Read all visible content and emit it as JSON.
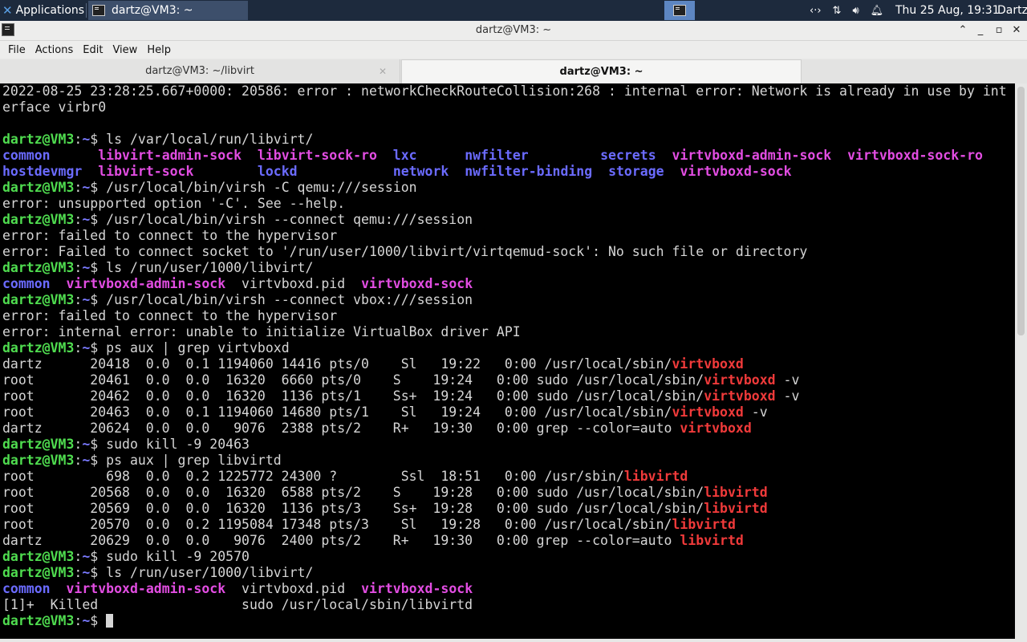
{
  "taskbar": {
    "applications_label": "Applications",
    "task_label": "dartz@VM3: ~",
    "clock": "Thu 25 Aug, 19:31",
    "user": "Dartz"
  },
  "window": {
    "title": "dartz@VM3: ~",
    "menu": [
      "File",
      "Actions",
      "Edit",
      "View",
      "Help"
    ]
  },
  "tabs": [
    {
      "label": "dartz@VM3: ~/libvirt"
    },
    {
      "label": "dartz@VM3: ~"
    }
  ],
  "terminal": {
    "prompt": "dartz@VM3",
    "lines": [
      [
        {
          "t": "2022-08-25 23:28:25.667+0000: 20586: error : networkCheckRouteCollision:268 : internal error: Network is already in use by int"
        }
      ],
      [
        {
          "t": "erface virbr0"
        }
      ],
      [
        {
          "t": ""
        }
      ],
      [
        {
          "t": "dartz@VM3",
          "c": "pg"
        },
        {
          "t": ":"
        },
        {
          "t": "~",
          "c": "pb"
        },
        {
          "t": "$ ls /var/local/run/libvirt/"
        }
      ],
      [
        {
          "t": "common",
          "c": "dir"
        },
        {
          "t": "      "
        },
        {
          "t": "libvirt-admin-sock",
          "c": "sock"
        },
        {
          "t": "  "
        },
        {
          "t": "libvirt-sock-ro",
          "c": "sock"
        },
        {
          "t": "  "
        },
        {
          "t": "lxc",
          "c": "dir"
        },
        {
          "t": "      "
        },
        {
          "t": "nwfilter",
          "c": "dir"
        },
        {
          "t": "         "
        },
        {
          "t": "secrets",
          "c": "dir"
        },
        {
          "t": "  "
        },
        {
          "t": "virtvboxd-admin-sock",
          "c": "sock"
        },
        {
          "t": "  "
        },
        {
          "t": "virtvboxd-sock-ro",
          "c": "sock"
        }
      ],
      [
        {
          "t": "hostdevmgr",
          "c": "dir"
        },
        {
          "t": "  "
        },
        {
          "t": "libvirt-sock",
          "c": "sock"
        },
        {
          "t": "        "
        },
        {
          "t": "lockd",
          "c": "dir"
        },
        {
          "t": "            "
        },
        {
          "t": "network",
          "c": "dir"
        },
        {
          "t": "  "
        },
        {
          "t": "nwfilter-binding",
          "c": "dir"
        },
        {
          "t": "  "
        },
        {
          "t": "storage",
          "c": "dir"
        },
        {
          "t": "  "
        },
        {
          "t": "virtvboxd-sock",
          "c": "sock"
        }
      ],
      [
        {
          "t": "dartz@VM3",
          "c": "pg"
        },
        {
          "t": ":"
        },
        {
          "t": "~",
          "c": "pb"
        },
        {
          "t": "$ /usr/local/bin/virsh -C qemu:///session"
        }
      ],
      [
        {
          "t": "error: unsupported option '-C'. See --help."
        }
      ],
      [
        {
          "t": "dartz@VM3",
          "c": "pg"
        },
        {
          "t": ":"
        },
        {
          "t": "~",
          "c": "pb"
        },
        {
          "t": "$ /usr/local/bin/virsh --connect qemu:///session"
        }
      ],
      [
        {
          "t": "error: failed to connect to the hypervisor"
        }
      ],
      [
        {
          "t": "error: Failed to connect socket to '/run/user/1000/libvirt/virtqemud-sock': No such file or directory"
        }
      ],
      [
        {
          "t": "dartz@VM3",
          "c": "pg"
        },
        {
          "t": ":"
        },
        {
          "t": "~",
          "c": "pb"
        },
        {
          "t": "$ ls /run/user/1000/libvirt/"
        }
      ],
      [
        {
          "t": "common",
          "c": "dir"
        },
        {
          "t": "  "
        },
        {
          "t": "virtvboxd-admin-sock",
          "c": "sock"
        },
        {
          "t": "  virtvboxd.pid  "
        },
        {
          "t": "virtvboxd-sock",
          "c": "sock"
        }
      ],
      [
        {
          "t": "dartz@VM3",
          "c": "pg"
        },
        {
          "t": ":"
        },
        {
          "t": "~",
          "c": "pb"
        },
        {
          "t": "$ /usr/local/bin/virsh --connect vbox:///session"
        }
      ],
      [
        {
          "t": "error: failed to connect to the hypervisor"
        }
      ],
      [
        {
          "t": "error: internal error: unable to initialize VirtualBox driver API"
        }
      ],
      [
        {
          "t": "dartz@VM3",
          "c": "pg"
        },
        {
          "t": ":"
        },
        {
          "t": "~",
          "c": "pb"
        },
        {
          "t": "$ ps aux | grep virtvboxd"
        }
      ],
      [
        {
          "t": "dartz      20418  0.0  0.1 1194060 14416 pts/0    Sl   19:22   0:00 /usr/local/sbin/"
        },
        {
          "t": "virtvboxd",
          "c": "hl"
        }
      ],
      [
        {
          "t": "root       20461  0.0  0.0  16320  6660 pts/0    S    19:24   0:00 sudo /usr/local/sbin/"
        },
        {
          "t": "virtvboxd",
          "c": "hl"
        },
        {
          "t": " -v"
        }
      ],
      [
        {
          "t": "root       20462  0.0  0.0  16320  1136 pts/1    Ss+  19:24   0:00 sudo /usr/local/sbin/"
        },
        {
          "t": "virtvboxd",
          "c": "hl"
        },
        {
          "t": " -v"
        }
      ],
      [
        {
          "t": "root       20463  0.0  0.1 1194060 14680 pts/1    Sl   19:24   0:00 /usr/local/sbin/"
        },
        {
          "t": "virtvboxd",
          "c": "hl"
        },
        {
          "t": " -v"
        }
      ],
      [
        {
          "t": "dartz      20624  0.0  0.0   9076  2388 pts/2    R+   19:30   0:00 grep --color=auto "
        },
        {
          "t": "virtvboxd",
          "c": "hl"
        }
      ],
      [
        {
          "t": "dartz@VM3",
          "c": "pg"
        },
        {
          "t": ":"
        },
        {
          "t": "~",
          "c": "pb"
        },
        {
          "t": "$ sudo kill -9 20463"
        }
      ],
      [
        {
          "t": "dartz@VM3",
          "c": "pg"
        },
        {
          "t": ":"
        },
        {
          "t": "~",
          "c": "pb"
        },
        {
          "t": "$ ps aux | grep libvirtd"
        }
      ],
      [
        {
          "t": "root         698  0.0  0.2 1225772 24300 ?        Ssl  18:51   0:00 /usr/sbin/"
        },
        {
          "t": "libvirtd",
          "c": "hl"
        }
      ],
      [
        {
          "t": "root       20568  0.0  0.0  16320  6588 pts/2    S    19:28   0:00 sudo /usr/local/sbin/"
        },
        {
          "t": "libvirtd",
          "c": "hl"
        }
      ],
      [
        {
          "t": "root       20569  0.0  0.0  16320  1136 pts/3    Ss+  19:28   0:00 sudo /usr/local/sbin/"
        },
        {
          "t": "libvirtd",
          "c": "hl"
        }
      ],
      [
        {
          "t": "root       20570  0.0  0.2 1195084 17348 pts/3    Sl   19:28   0:00 /usr/local/sbin/"
        },
        {
          "t": "libvirtd",
          "c": "hl"
        }
      ],
      [
        {
          "t": "dartz      20629  0.0  0.0   9076  2400 pts/2    R+   19:30   0:00 grep --color=auto "
        },
        {
          "t": "libvirtd",
          "c": "hl"
        }
      ],
      [
        {
          "t": "dartz@VM3",
          "c": "pg"
        },
        {
          "t": ":"
        },
        {
          "t": "~",
          "c": "pb"
        },
        {
          "t": "$ sudo kill -9 20570"
        }
      ],
      [
        {
          "t": "dartz@VM3",
          "c": "pg"
        },
        {
          "t": ":"
        },
        {
          "t": "~",
          "c": "pb"
        },
        {
          "t": "$ ls /run/user/1000/libvirt/"
        }
      ],
      [
        {
          "t": "common",
          "c": "dir"
        },
        {
          "t": "  "
        },
        {
          "t": "virtvboxd-admin-sock",
          "c": "sock"
        },
        {
          "t": "  virtvboxd.pid  "
        },
        {
          "t": "virtvboxd-sock",
          "c": "sock"
        }
      ],
      [
        {
          "t": "[1]+  Killed                  sudo /usr/local/sbin/libvirtd"
        }
      ],
      [
        {
          "t": "dartz@VM3",
          "c": "pg"
        },
        {
          "t": ":"
        },
        {
          "t": "~",
          "c": "pb"
        },
        {
          "t": "$ "
        },
        {
          "cursor": true
        }
      ]
    ]
  },
  "colors": {
    "prompt_user": "#4fdc4f",
    "prompt_path": "#7a7aff",
    "directory": "#6b6bff",
    "socket": "#e24de2",
    "grep_match": "#f03a3a",
    "terminal_bg": "#000000",
    "terminal_fg": "#d6d6d6"
  }
}
